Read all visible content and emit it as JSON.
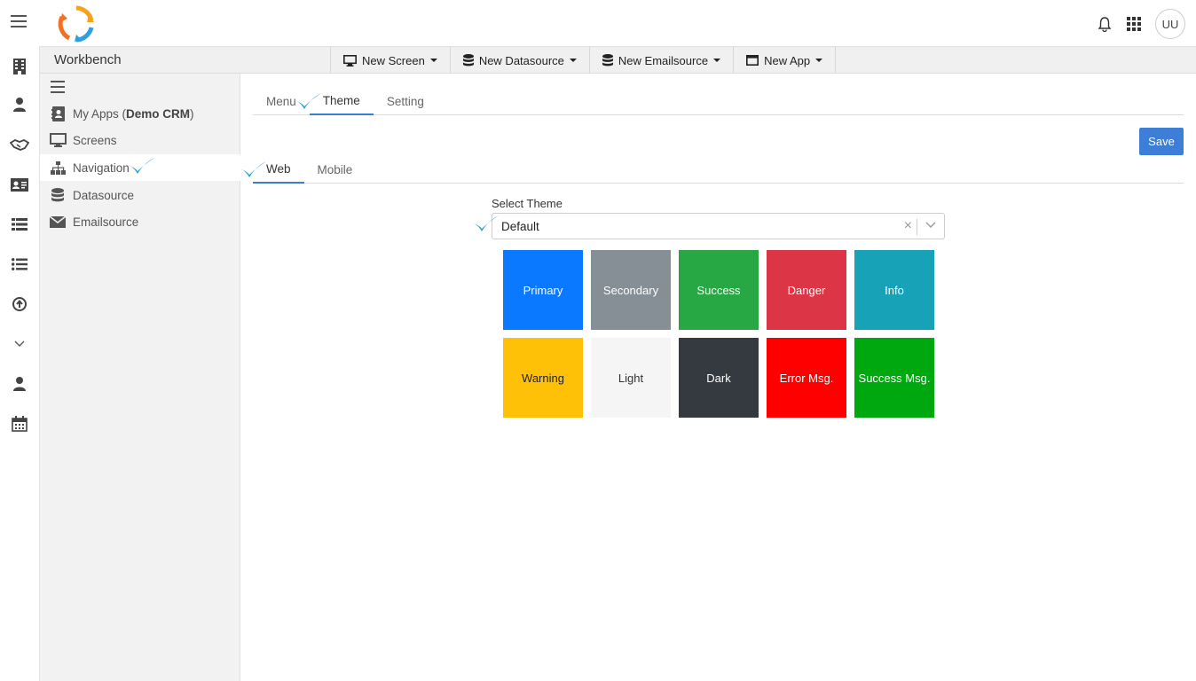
{
  "header": {
    "user_initials": "UU"
  },
  "workbench": {
    "title": "Workbench",
    "menu": [
      {
        "label": "New Screen",
        "icon": "monitor-icon"
      },
      {
        "label": "New Datasource",
        "icon": "database-icon"
      },
      {
        "label": "New Emailsource",
        "icon": "database-icon"
      },
      {
        "label": "New App",
        "icon": "window-icon"
      }
    ]
  },
  "sidebar": {
    "items": [
      {
        "label": "My Apps (",
        "bold": "Demo CRM",
        "suffix": ")",
        "icon": "contact-book-icon"
      },
      {
        "label": "Screens",
        "icon": "monitor-icon"
      },
      {
        "label": "Navigation",
        "icon": "sitemap-icon"
      },
      {
        "label": "Datasource",
        "icon": "database-icon"
      },
      {
        "label": "Emailsource",
        "icon": "envelope-icon"
      }
    ]
  },
  "main": {
    "tabs": [
      "Menu",
      "Theme",
      "Setting"
    ],
    "save_label": "Save",
    "subtabs": [
      "Web",
      "Mobile"
    ],
    "select_label": "Select Theme",
    "select_value": "Default",
    "swatches": [
      {
        "label": "Primary",
        "bg": "#0a78ff",
        "fg": "#ffffff"
      },
      {
        "label": "Secondary",
        "bg": "#868e96",
        "fg": "#ffffff"
      },
      {
        "label": "Success",
        "bg": "#28a745",
        "fg": "#ffffff"
      },
      {
        "label": "Danger",
        "bg": "#dc3545",
        "fg": "#ffffff"
      },
      {
        "label": "Info",
        "bg": "#17a2b8",
        "fg": "#ffffff"
      },
      {
        "label": "Warning",
        "bg": "#ffc107",
        "fg": "#222222"
      },
      {
        "label": "Light",
        "bg": "#f5f5f5",
        "fg": "#333333"
      },
      {
        "label": "Dark",
        "bg": "#343a40",
        "fg": "#ffffff"
      },
      {
        "label": "Error Msg.",
        "bg": "#ff0000",
        "fg": "#ffffff"
      },
      {
        "label": "Success Msg.",
        "bg": "#00a80f",
        "fg": "#ffffff"
      }
    ]
  },
  "colors": {
    "accent": "#3d7fd6",
    "checkmark": "#2a9fd8"
  }
}
